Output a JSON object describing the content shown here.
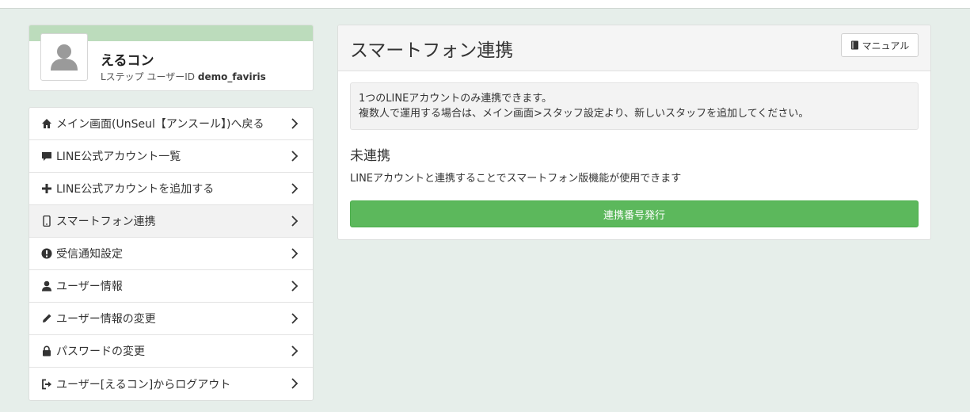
{
  "profile": {
    "name": "えるコン",
    "sub_prefix": "Lステップ ユーザーID",
    "user_id": "demo_faviris"
  },
  "menu": [
    {
      "icon": "home-icon",
      "label": "メイン画面(UnSeul【アンスール】)へ戻る"
    },
    {
      "icon": "comment-icon",
      "label": "LINE公式アカウント一覧"
    },
    {
      "icon": "plus-icon",
      "label": "LINE公式アカウントを追加する"
    },
    {
      "icon": "smartphone-icon",
      "label": "スマートフォン連携"
    },
    {
      "icon": "exclamation-circle-icon",
      "label": "受信通知設定"
    },
    {
      "icon": "user-icon",
      "label": "ユーザー情報"
    },
    {
      "icon": "pencil-icon",
      "label": "ユーザー情報の変更"
    },
    {
      "icon": "lock-icon",
      "label": "パスワードの変更"
    },
    {
      "icon": "logout-icon",
      "label": "ユーザー[えるコン]からログアウト"
    }
  ],
  "panel": {
    "title": "スマートフォン連携",
    "manual_label": "マニュアル",
    "notice_line1": "1つのLINEアカウントのみ連携できます。",
    "notice_line2": "複数人で運用する場合は、メイン画面>スタッフ設定より、新しいスタッフを追加してください。",
    "status_title": "未連携",
    "status_desc": "LINEアカウントと連携することでスマートフォン版機能が使用できます",
    "issue_button": "連携番号発行"
  },
  "colors": {
    "accent_green": "#5cb85c",
    "profile_band": "#bcdcbc",
    "page_bg": "#e6eeea"
  }
}
